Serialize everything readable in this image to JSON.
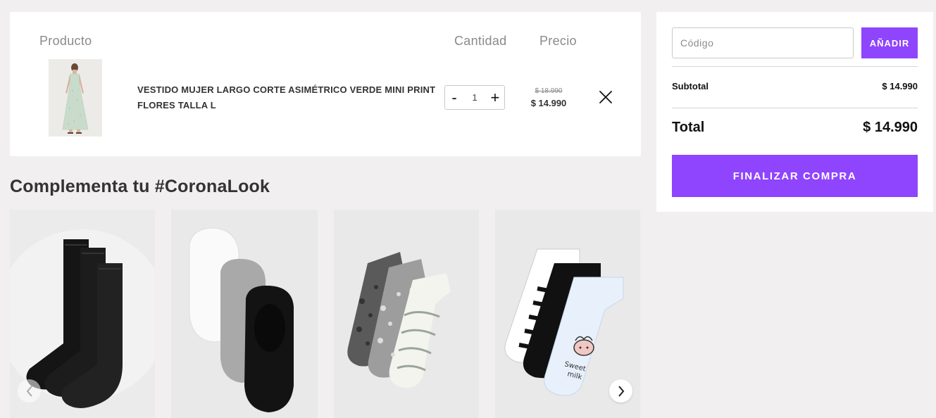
{
  "cart": {
    "headers": {
      "product": "Producto",
      "quantity": "Cantidad",
      "price": "Precio"
    },
    "item": {
      "name": "VESTIDO MUJER LARGO CORTE ASIMÉTRICO VERDE MINI PRINT FLORES TALLA L",
      "quantity": "1",
      "minus_label": "-",
      "plus_label": "+",
      "price_old": "$ 18.990",
      "price_new": "$ 14.990"
    }
  },
  "recommendations": {
    "title": "Complementa tu #CoronaLook",
    "items": [
      {
        "icon": "black-socks-3-pack"
      },
      {
        "icon": "invisible-socks-3-pack"
      },
      {
        "icon": "animal-print-socks-3-pack"
      },
      {
        "icon": "striped-cow-socks-3-pack"
      }
    ]
  },
  "summary": {
    "code_placeholder": "Código",
    "add_label": "AÑADIR",
    "subtotal_label": "Subtotal",
    "subtotal_value": "$ 14.990",
    "total_label": "Total",
    "total_value": "$ 14.990",
    "checkout_label": "FINALIZAR COMPRA"
  },
  "colors": {
    "accent": "#8f44fd",
    "page_bg": "#f1efef"
  }
}
